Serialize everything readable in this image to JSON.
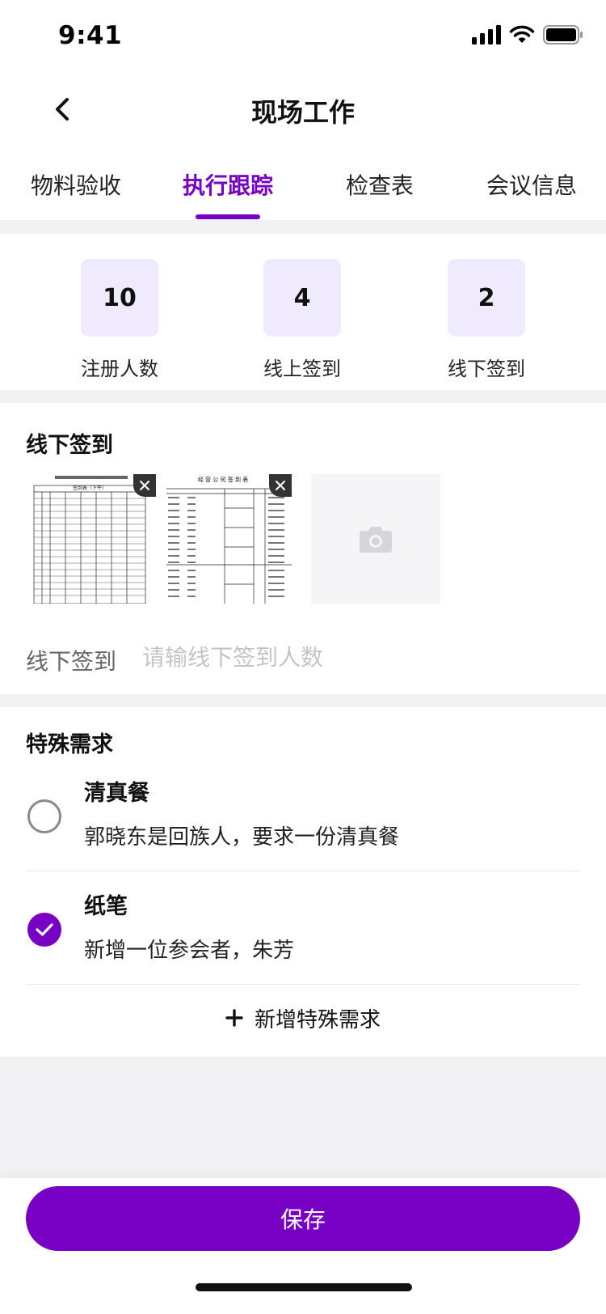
{
  "status_bar": {
    "time": "9:41"
  },
  "nav": {
    "title": "现场工作"
  },
  "tabs": [
    {
      "label": "物料验收",
      "active": false
    },
    {
      "label": "执行跟踪",
      "active": true
    },
    {
      "label": "检查表",
      "active": false
    },
    {
      "label": "会议信息",
      "active": false
    }
  ],
  "stats": [
    {
      "value": "10",
      "label": "注册人数"
    },
    {
      "value": "4",
      "label": "线上签到"
    },
    {
      "value": "2",
      "label": "线下签到"
    }
  ],
  "offline_checkin": {
    "title": "线下签到",
    "photos": [
      {
        "sheet_title": "签到表（下午）"
      },
      {
        "sheet_title": "经 营 公 司 签 到 表"
      }
    ],
    "field_label": "线下签到",
    "field_placeholder": "请输线下签到人数",
    "field_value": ""
  },
  "special_requests": {
    "title": "特殊需求",
    "items": [
      {
        "title": "清真餐",
        "desc": "郭晓东是回族人，要求一份清真餐",
        "checked": false
      },
      {
        "title": "纸笔",
        "desc": "新增一位参会者，朱芳",
        "checked": true
      }
    ],
    "add_label": "新增特殊需求"
  },
  "footer": {
    "save_label": "保存"
  },
  "colors": {
    "accent": "#7700c4",
    "stat_bg": "#efeafe",
    "page_gap": "#f2f2f4"
  }
}
